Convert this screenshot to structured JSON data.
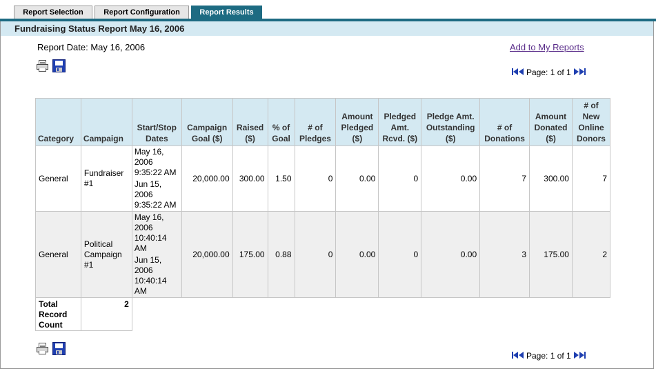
{
  "tabs": [
    {
      "label": "Report Selection"
    },
    {
      "label": "Report Configuration"
    },
    {
      "label": "Report Results"
    }
  ],
  "title": "Fundraising Status Report May 16, 2006",
  "report_date": "Report Date: May 16, 2006",
  "add_link": "Add to My Reports",
  "pager": {
    "text": "Page: 1 of 1"
  },
  "table": {
    "headers": [
      "Category",
      "Campaign",
      "Start/Stop Dates",
      "Campaign Goal ($)",
      "Raised ($)",
      "% of Goal",
      "# of Pledges",
      "Amount Pledged ($)",
      "Pledged Amt. Rcvd. ($)",
      "Pledge Amt. Outstanding ($)",
      "# of Donations",
      "Amount Donated ($)",
      "# of New Online Donors"
    ],
    "rows": [
      {
        "category": "General",
        "campaign": "Fundraiser #1",
        "start": "May 16, 2006 9:35:22 AM",
        "stop": "Jun 15, 2006 9:35:22 AM",
        "goal": "20,000.00",
        "raised": "300.00",
        "pct": "1.50",
        "pledges": "0",
        "pledged": "0.00",
        "rcvd": "0",
        "outstanding": "0.00",
        "donations": "7",
        "donated": "300.00",
        "new_donors": "7"
      },
      {
        "category": "General",
        "campaign": "Political Campaign #1",
        "start": "May 16, 2006 10:40:14 AM",
        "stop": "Jun 15, 2006 10:40:14 AM",
        "goal": "20,000.00",
        "raised": "175.00",
        "pct": "0.88",
        "pledges": "0",
        "pledged": "0.00",
        "rcvd": "0",
        "outstanding": "0.00",
        "donations": "3",
        "donated": "175.00",
        "new_donors": "2"
      }
    ],
    "total_label": "Total Record Count",
    "total_value": "2"
  },
  "icons": {
    "print": "print-icon",
    "save": "save-icon",
    "first": "first-page-icon",
    "prev": "prev-page-icon",
    "next": "next-page-icon",
    "last": "last-page-icon"
  },
  "colors": {
    "accent": "#1d6b82",
    "header_bg": "#d4e9f2",
    "link": "#5a2d8a",
    "icon_blue": "#1f3fb0"
  }
}
